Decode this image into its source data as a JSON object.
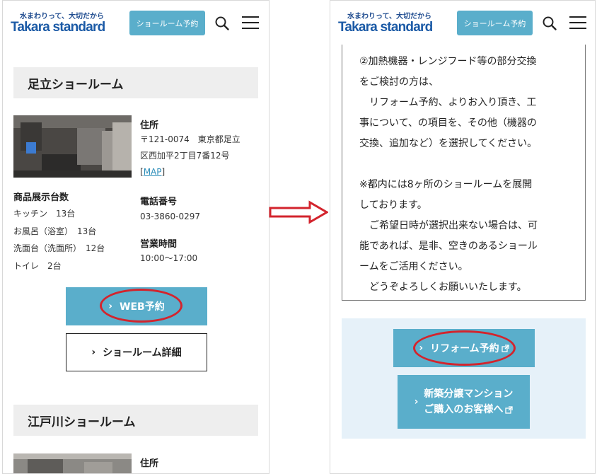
{
  "header": {
    "tagline": "水まわりって、大切だから",
    "logo": "Takara standard",
    "showroom_button": "ショールーム予約"
  },
  "left": {
    "showroom1": {
      "heading": "足立ショールーム",
      "stats_title": "商品展示台数",
      "stats": [
        "キッチン　13台",
        "お風呂（浴室）　13台",
        "洗面台（洗面所）　12台",
        "トイレ　2台"
      ],
      "address_label": "住所",
      "address_lines": [
        "〒121-0074　東京都足立",
        "区西加平2丁目7番12号"
      ],
      "map_link": "MAP",
      "phone_label": "電話番号",
      "phone": "03-3860-0297",
      "hours_label": "営業時間",
      "hours": "10:00〜17:00",
      "web_button": "WEB予約",
      "detail_button": "ショールーム詳細"
    },
    "showroom2": {
      "heading": "江戸川ショールーム",
      "address_label": "住所"
    }
  },
  "right": {
    "notice_lines": [
      "②加熱機器・レンジフード等の部分交換",
      "をご検討の方は、",
      "　リフォーム予約、よりお入り頂き、工",
      "事について、の項目を、その他（機器の",
      "交換、追加など）を選択してください。",
      "",
      "※都内には8ヶ所のショールームを展開",
      "しております。",
      "　ご希望日時が選択出来ない場合は、可",
      "能であれば、是非、空きのあるショール",
      "ームをご活用ください。",
      "　どうぞよろしくお願いいたします。"
    ],
    "reform_button": "リフォーム予約",
    "mansion_button_line1": "新築分譲マンション",
    "mansion_button_line2": "ご購入のお客様へ"
  },
  "colors": {
    "accent": "#5aaecb",
    "logo": "#1b5aa6",
    "highlight": "#d3242d",
    "cta_background": "#e6f1f9"
  }
}
